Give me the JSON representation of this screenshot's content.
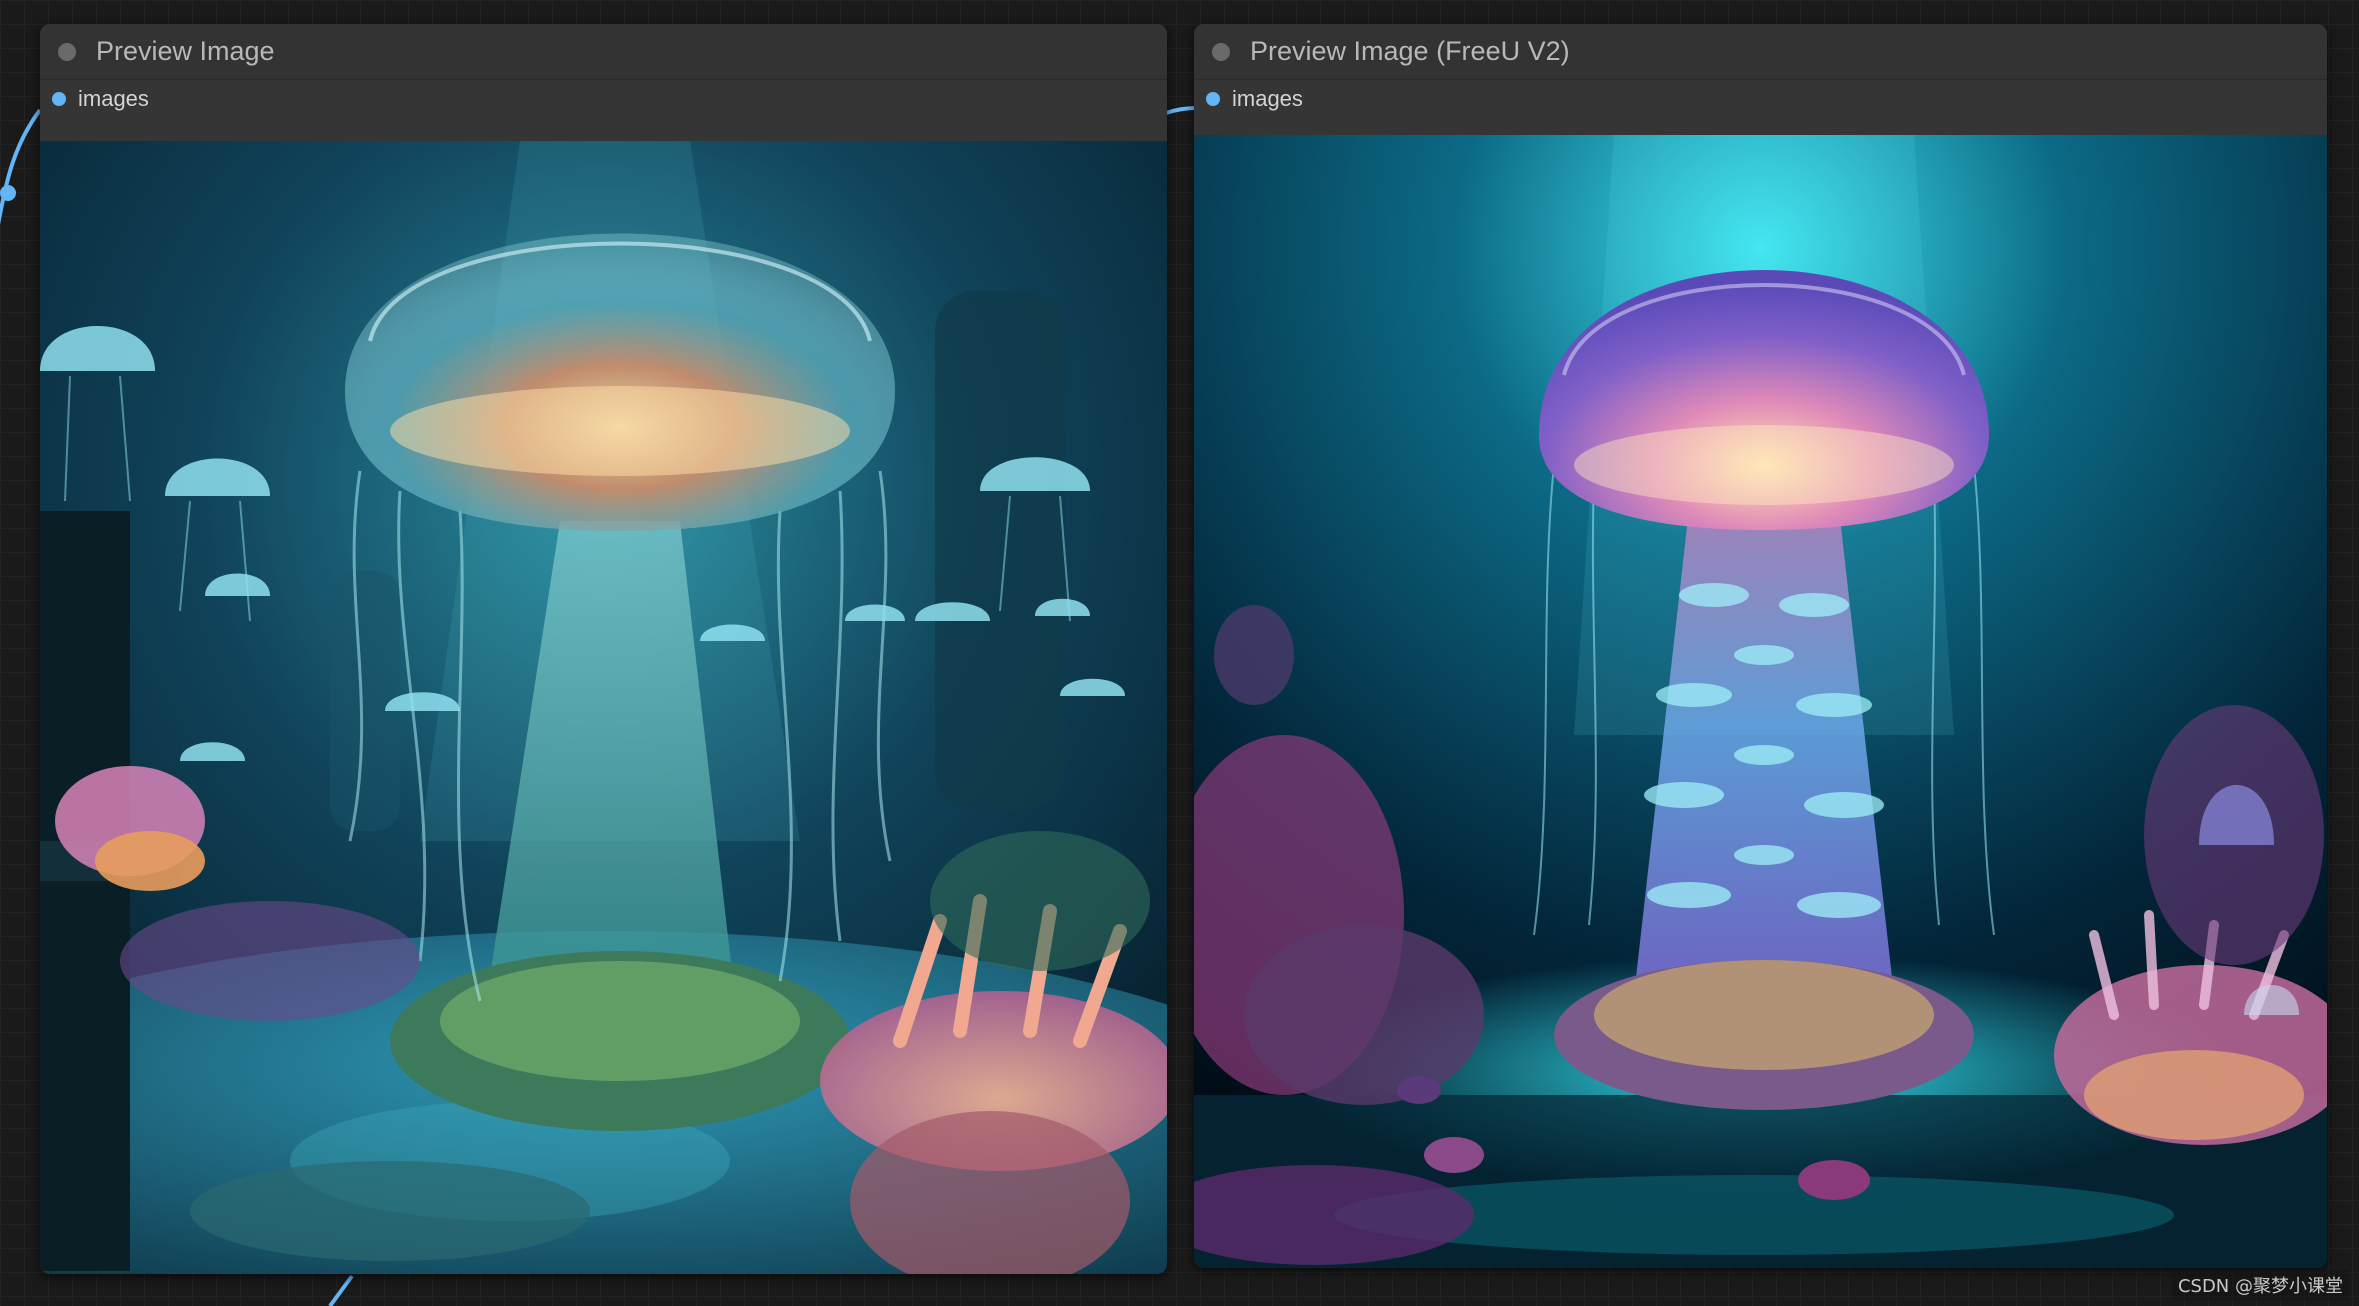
{
  "nodes": [
    {
      "title": "Preview Image",
      "slot_label": "images",
      "image_subject": "bioluminescent cyan jellyfish in an underwater coral scene"
    },
    {
      "title": "Preview Image (FreeU V2)",
      "slot_label": "images",
      "image_subject": "glowing violet-blue jellyfish over a coral island"
    }
  ],
  "watermark": "CSDN @聚梦小课堂",
  "colors": {
    "canvas_bg": "#1a1a1a",
    "node_bg": "#353535",
    "slot_accent": "#64b5f6",
    "link_color": "#64b5f6"
  },
  "icons": {
    "collapse": "circle-dot-icon",
    "input_slot": "blue-dot-icon"
  }
}
